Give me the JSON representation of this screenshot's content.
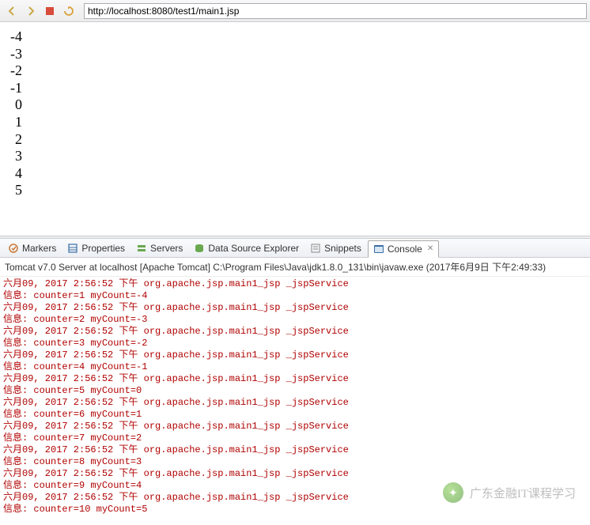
{
  "toolbar": {
    "url": "http://localhost:8080/test1/main1.jsp"
  },
  "page_output": [
    "-4",
    "-3",
    "-2",
    "-1",
    "0",
    "1",
    "2",
    "3",
    "4",
    "5"
  ],
  "tabs": {
    "markers": "Markers",
    "properties": "Properties",
    "servers": "Servers",
    "data_source": "Data Source Explorer",
    "snippets": "Snippets",
    "console": "Console"
  },
  "server_line": "Tomcat v7.0 Server at localhost [Apache Tomcat] C:\\Program Files\\Java\\jdk1.8.0_131\\bin\\javaw.exe (2017年6月9日 下午2:49:33)",
  "console_lines": [
    "六月09, 2017 2:56:52 下午 org.apache.jsp.main1_jsp _jspService",
    "信息: counter=1 myCount=-4",
    "六月09, 2017 2:56:52 下午 org.apache.jsp.main1_jsp _jspService",
    "信息: counter=2 myCount=-3",
    "六月09, 2017 2:56:52 下午 org.apache.jsp.main1_jsp _jspService",
    "信息: counter=3 myCount=-2",
    "六月09, 2017 2:56:52 下午 org.apache.jsp.main1_jsp _jspService",
    "信息: counter=4 myCount=-1",
    "六月09, 2017 2:56:52 下午 org.apache.jsp.main1_jsp _jspService",
    "信息: counter=5 myCount=0",
    "六月09, 2017 2:56:52 下午 org.apache.jsp.main1_jsp _jspService",
    "信息: counter=6 myCount=1",
    "六月09, 2017 2:56:52 下午 org.apache.jsp.main1_jsp _jspService",
    "信息: counter=7 myCount=2",
    "六月09, 2017 2:56:52 下午 org.apache.jsp.main1_jsp _jspService",
    "信息: counter=8 myCount=3",
    "六月09, 2017 2:56:52 下午 org.apache.jsp.main1_jsp _jspService",
    "信息: counter=9 myCount=4",
    "六月09, 2017 2:56:52 下午 org.apache.jsp.main1_jsp _jspService",
    "信息: counter=10 myCount=5"
  ],
  "watermark": {
    "text": "广东金融IT课程学习"
  }
}
